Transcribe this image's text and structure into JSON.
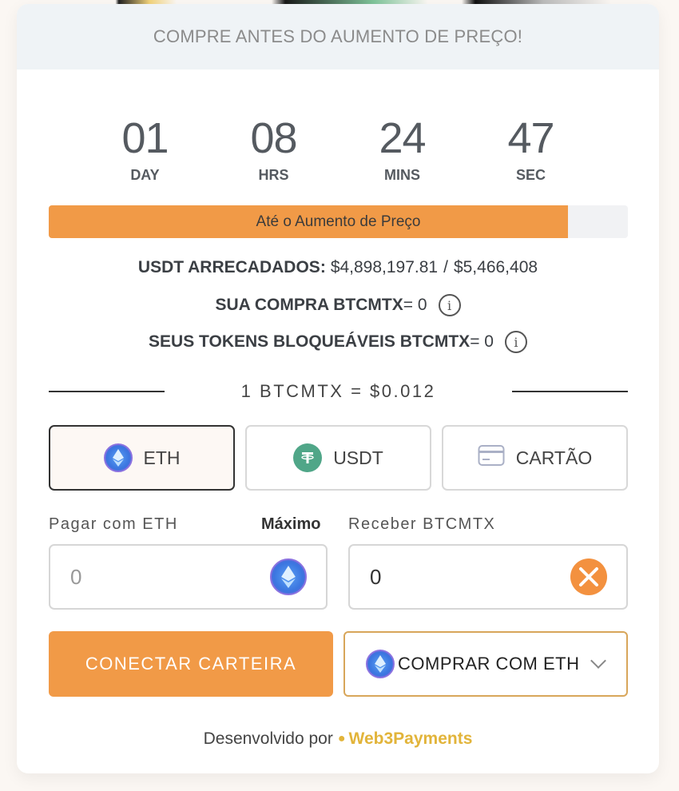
{
  "banner": {
    "text": "COMPRE ANTES DO AUMENTO DE PREÇO!"
  },
  "countdown": [
    {
      "value": "01",
      "label": "DAY"
    },
    {
      "value": "08",
      "label": "HRS"
    },
    {
      "value": "24",
      "label": "MINS"
    },
    {
      "value": "47",
      "label": "SEC"
    }
  ],
  "progress": {
    "label": "Até o Aumento de Preço",
    "percent": 89.6
  },
  "stats": {
    "raised_label": "USDT ARRECADADOS:",
    "raised_value": "$4,898,197.81",
    "separator": "/",
    "raised_goal": "$5,466,408",
    "purchase_label": "SUA COMPRA BTCMTX",
    "purchase_value": "= 0",
    "stakeable_label": "SEUS TOKENS BLOQUEÁVEIS BTCMTX",
    "stakeable_value": "= 0"
  },
  "rate": {
    "text": "1 BTCMTX = $0.012"
  },
  "pay_tabs": [
    {
      "label": "ETH",
      "icon": "ethereum-icon",
      "active": true
    },
    {
      "label": "USDT",
      "icon": "tether-icon",
      "active": false
    },
    {
      "label": "CARTÃO",
      "icon": "credit-card-icon",
      "active": false
    }
  ],
  "pay_field": {
    "label": "Pagar com ETH",
    "max_label": "Máximo",
    "value": "0",
    "icon": "ethereum-icon"
  },
  "receive_field": {
    "label": "Receber BTCMTX",
    "value": "0",
    "icon": "btcmtx-icon"
  },
  "actions": {
    "connect_label": "CONECTAR CARTEIRA",
    "buy_label": "COMPRAR COM ETH"
  },
  "footer": {
    "prefix": "Desenvolvido por",
    "brand": "Web3Payments"
  },
  "colors": {
    "accent": "#f19a47",
    "brand": "#e2b43a",
    "eth": "#3b76e0",
    "usdt": "#50a688"
  }
}
